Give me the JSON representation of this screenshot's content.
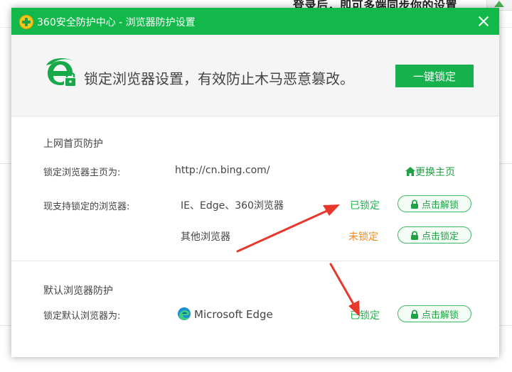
{
  "background": {
    "partial_text": "登录后，即可多端同步你的设置"
  },
  "window": {
    "title": "360安全防护中心 - 浏览器防护设置"
  },
  "header": {
    "description": "锁定浏览器设置，有效防止木马恶意篡改。",
    "lock_all_button": "一键锁定"
  },
  "homepage_protection": {
    "section_title": "上网首页防护",
    "homepage_label": "锁定浏览器主页为:",
    "homepage_url": "http://cn.bing.com/",
    "change_homepage_link": "更换主页",
    "supported_label": "现支持锁定的浏览器:",
    "browsers": [
      {
        "name": "IE、Edge、360浏览器",
        "status": "已锁定",
        "action": "点击解锁"
      },
      {
        "name": "其他浏览器",
        "status": "未锁定",
        "action": "点击锁定"
      }
    ]
  },
  "default_browser_protection": {
    "section_title": "默认浏览器防护",
    "default_label": "锁定默认浏览器为:",
    "browser_name": "Microsoft Edge",
    "status": "已锁定",
    "action": "点击解锁"
  },
  "colors": {
    "brand_green": "#12b94a",
    "status_locked": "#22b24c",
    "status_unlocked": "#f08a1c",
    "annotation_arrow": "#e8382c"
  },
  "icons": [
    "360-logo-icon",
    "close-icon",
    "ie-lock-icon",
    "home-icon",
    "lock-icon",
    "edge-icon"
  ]
}
